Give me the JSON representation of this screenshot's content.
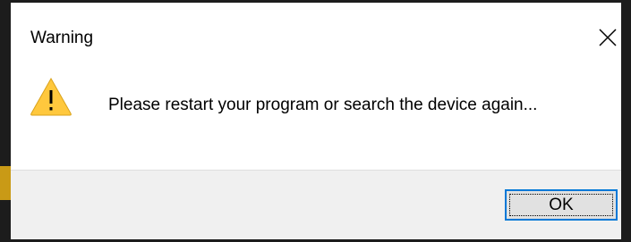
{
  "window": {
    "title": "Warning",
    "close_icon": "close-icon"
  },
  "dialog": {
    "icon": "warning-icon",
    "icon_color": "#ffc83d",
    "message": "Please restart your program or search the device again..."
  },
  "buttons": {
    "ok_label": "OK"
  },
  "colors": {
    "accent": "#0078d7",
    "footer_background": "#f0f0f0",
    "button_background": "#e1e1e1"
  }
}
